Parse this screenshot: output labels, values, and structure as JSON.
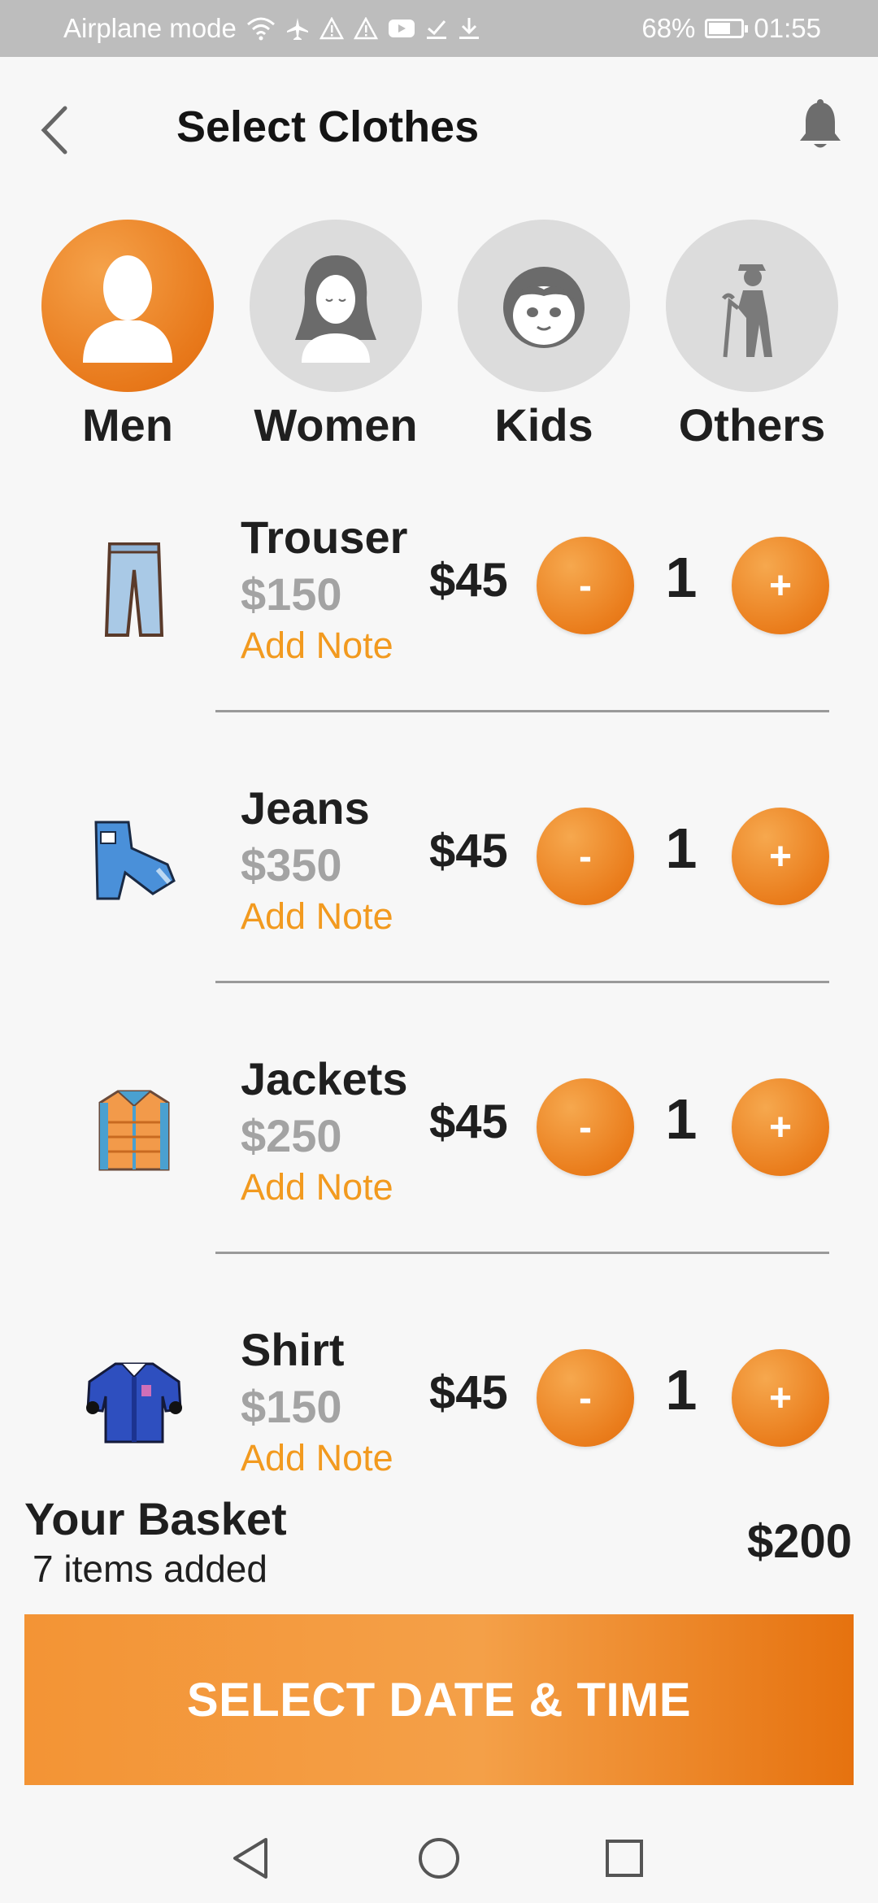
{
  "status_bar": {
    "left_text": "Airplane mode",
    "battery_text": "68%",
    "battery_level": 0.68,
    "time": "01:55",
    "icons": [
      "wifi-icon",
      "airplane-icon",
      "warning-icon",
      "warning-icon",
      "youtube-icon",
      "check-icon",
      "download-icon",
      "battery-icon"
    ]
  },
  "header": {
    "title": "Select Clothes",
    "back_icon": "chevron-left-icon",
    "bell_icon": "bell-icon"
  },
  "categories": [
    {
      "label": "Men",
      "icon": "man-icon",
      "active": true
    },
    {
      "label": "Women",
      "icon": "woman-icon",
      "active": false
    },
    {
      "label": "Kids",
      "icon": "kid-icon",
      "active": false
    },
    {
      "label": "Others",
      "icon": "elder-icon",
      "active": false
    }
  ],
  "items": [
    {
      "name": "Trouser",
      "price": "$150",
      "note": "Add Note",
      "unit_price": "$45",
      "minus": "-",
      "qty": "1",
      "plus": "+",
      "icon": "trouser-icon"
    },
    {
      "name": "Jeans",
      "price": "$350",
      "note": "Add Note",
      "unit_price": "$45",
      "minus": "-",
      "qty": "1",
      "plus": "+",
      "icon": "jeans-icon"
    },
    {
      "name": "Jackets",
      "price": "$250",
      "note": "Add Note",
      "unit_price": "$45",
      "minus": "-",
      "qty": "1",
      "plus": "+",
      "icon": "jacket-icon"
    },
    {
      "name": "Shirt",
      "price": "$150",
      "note": "Add Note",
      "unit_price": "$45",
      "minus": "-",
      "qty": "1",
      "plus": "+",
      "icon": "shirt-icon"
    }
  ],
  "basket": {
    "title": "Your Basket",
    "count_text": "7 items added",
    "total": "$200"
  },
  "cta_label": "SELECT DATE & TIME",
  "nav": {
    "back_icon": "nav-back-icon",
    "home_icon": "nav-home-icon",
    "recents_icon": "nav-recents-icon"
  },
  "colors": {
    "accent": "#EE8A2A",
    "note": "#F29A1F",
    "price_muted": "#A3A3A3",
    "status_bar": "#BDBDBD"
  }
}
